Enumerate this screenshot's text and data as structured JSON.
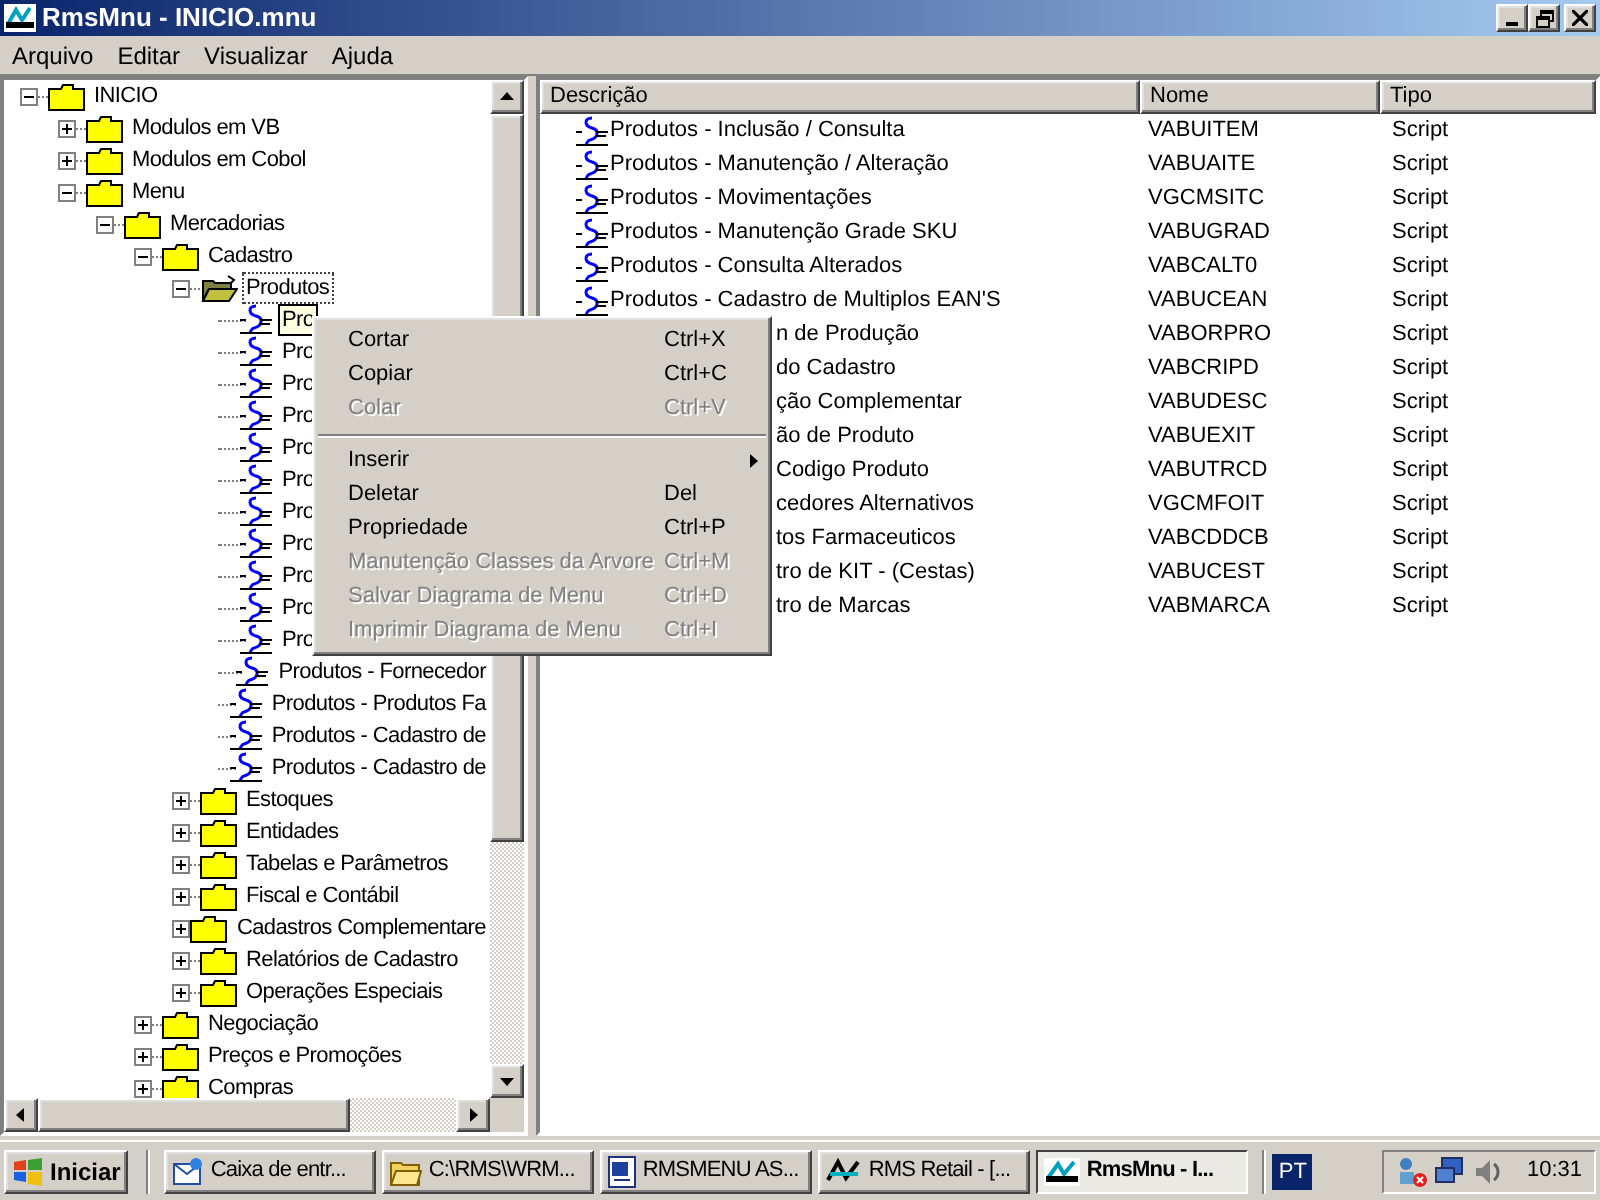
{
  "window": {
    "title": "RmsMnu - INICIO.mnu"
  },
  "menu_bar": [
    "Arquivo",
    "Editar",
    "Visualizar",
    "Ajuda"
  ],
  "tree": [
    {
      "label": "INICIO",
      "kind": "folder",
      "expanded": true,
      "selected": false,
      "focused": false,
      "children": [
        {
          "label": "Modulos em VB",
          "kind": "folder",
          "expanded": false,
          "selected": false,
          "focused": false
        },
        {
          "label": "Modulos em Cobol",
          "kind": "folder",
          "expanded": false,
          "selected": false,
          "focused": false
        },
        {
          "label": "Menu",
          "kind": "folder",
          "expanded": true,
          "selected": false,
          "focused": false,
          "children": [
            {
              "label": "Mercadorias",
              "kind": "folder",
              "expanded": true,
              "selected": false,
              "focused": false,
              "children": [
                {
                  "label": "Cadastro",
                  "kind": "folder",
                  "expanded": true,
                  "selected": false,
                  "focused": false,
                  "children": [
                    {
                      "label": "Produtos",
                      "kind": "folder",
                      "expanded": true,
                      "selected": false,
                      "focused": true,
                      "children": [
                        {
                          "label": "Pro",
                          "kind": "script",
                          "selected": true,
                          "focused": false
                        },
                        {
                          "label": "Pro",
                          "kind": "script",
                          "selected": false,
                          "focused": false
                        },
                        {
                          "label": "Pro",
                          "kind": "script",
                          "selected": false,
                          "focused": false
                        },
                        {
                          "label": "Pro",
                          "kind": "script",
                          "selected": false,
                          "focused": false
                        },
                        {
                          "label": "Pro",
                          "kind": "script",
                          "selected": false,
                          "focused": false
                        },
                        {
                          "label": "Pro",
                          "kind": "script",
                          "selected": false,
                          "focused": false
                        },
                        {
                          "label": "Pro",
                          "kind": "script",
                          "selected": false,
                          "focused": false
                        },
                        {
                          "label": "Pro",
                          "kind": "script",
                          "selected": false,
                          "focused": false
                        },
                        {
                          "label": "Pro",
                          "kind": "script",
                          "selected": false,
                          "focused": false
                        },
                        {
                          "label": "Pro",
                          "kind": "script",
                          "selected": false,
                          "focused": false
                        },
                        {
                          "label": "Pro",
                          "kind": "script",
                          "selected": false,
                          "focused": false
                        },
                        {
                          "label": "Produtos - Fornecedor",
                          "kind": "script",
                          "selected": false,
                          "focused": false
                        },
                        {
                          "label": "Produtos - Produtos Fa",
                          "kind": "script",
                          "selected": false,
                          "focused": false
                        },
                        {
                          "label": "Produtos - Cadastro de",
                          "kind": "script",
                          "selected": false,
                          "focused": false
                        },
                        {
                          "label": "Produtos - Cadastro de",
                          "kind": "script",
                          "selected": false,
                          "focused": false
                        }
                      ]
                    },
                    {
                      "label": "Estoques",
                      "kind": "folder",
                      "expanded": false,
                      "selected": false,
                      "focused": false
                    },
                    {
                      "label": "Entidades",
                      "kind": "folder",
                      "expanded": false,
                      "selected": false,
                      "focused": false
                    },
                    {
                      "label": "Tabelas e Parâmetros",
                      "kind": "folder",
                      "expanded": false,
                      "selected": false,
                      "focused": false
                    },
                    {
                      "label": "Fiscal e Contábil",
                      "kind": "folder",
                      "expanded": false,
                      "selected": false,
                      "focused": false
                    },
                    {
                      "label": "Cadastros Complementare",
                      "kind": "folder",
                      "expanded": false,
                      "selected": false,
                      "focused": false
                    },
                    {
                      "label": "Relatórios de Cadastro",
                      "kind": "folder",
                      "expanded": false,
                      "selected": false,
                      "focused": false
                    },
                    {
                      "label": "Operações Especiais",
                      "kind": "folder",
                      "expanded": false,
                      "selected": false,
                      "focused": false
                    }
                  ]
                },
                {
                  "label": "Negociação",
                  "kind": "folder",
                  "expanded": false,
                  "selected": false,
                  "focused": false
                },
                {
                  "label": "Preços e Promoções",
                  "kind": "folder",
                  "expanded": false,
                  "selected": false,
                  "focused": false
                },
                {
                  "label": "Compras",
                  "kind": "folder",
                  "expanded": false,
                  "selected": false,
                  "focused": false
                }
              ]
            }
          ]
        }
      ]
    }
  ],
  "list": {
    "columns": [
      "Descrição",
      "Nome",
      "Tipo"
    ],
    "rows": [
      {
        "kind": "full",
        "description": "Produtos - Inclusão / Consulta",
        "name": "VABUITEM",
        "type": "Script"
      },
      {
        "kind": "full",
        "description": "Produtos - Manutenção / Alteração",
        "name": "VABUAITE",
        "type": "Script"
      },
      {
        "kind": "full",
        "description": "Produtos - Movimentações",
        "name": "VGCMSITC",
        "type": "Script"
      },
      {
        "kind": "full",
        "description": "Produtos - Manutenção Grade SKU",
        "name": "VABUGRAD",
        "type": "Script"
      },
      {
        "kind": "full",
        "description": "Produtos - Consulta Alterados",
        "name": "VABCALT0",
        "type": "Script"
      },
      {
        "kind": "full",
        "description": "Produtos - Cadastro de Multiplos EAN'S",
        "name": "VABUCEAN",
        "type": "Script"
      },
      {
        "kind": "partial",
        "description": "n de Produção",
        "name": "VABORPRO",
        "type": "Script"
      },
      {
        "kind": "partial",
        "description": "do Cadastro",
        "name": "VABCRIPD",
        "type": "Script"
      },
      {
        "kind": "partial",
        "description": "ção Complementar",
        "name": "VABUDESC",
        "type": "Script"
      },
      {
        "kind": "partial",
        "description": "ão de Produto",
        "name": "VABUEXIT",
        "type": "Script"
      },
      {
        "kind": "partial",
        "description": "Codigo Produto",
        "name": "VABUTRCD",
        "type": "Script"
      },
      {
        "kind": "partial",
        "description": "cedores Alternativos",
        "name": "VGCMFOIT",
        "type": "Script"
      },
      {
        "kind": "partial",
        "description": "tos Farmaceuticos",
        "name": "VABCDDCB",
        "type": "Script"
      },
      {
        "kind": "partial",
        "description": "tro de KIT - (Cestas)",
        "name": "VABUCEST",
        "type": "Script"
      },
      {
        "kind": "partial",
        "description": "tro de Marcas",
        "name": "VABMARCA",
        "type": "Script"
      }
    ]
  },
  "context_menu": [
    {
      "kind": "item",
      "label": "Cortar",
      "shortcut": "Ctrl+X",
      "disabled": false
    },
    {
      "kind": "item",
      "label": "Copiar",
      "shortcut": "Ctrl+C",
      "disabled": false
    },
    {
      "kind": "item",
      "label": "Colar",
      "shortcut": "Ctrl+V",
      "disabled": true
    },
    {
      "kind": "separator"
    },
    {
      "kind": "submenu",
      "label": "Inserir",
      "disabled": false
    },
    {
      "kind": "item",
      "label": "Deletar",
      "shortcut": "Del",
      "disabled": false
    },
    {
      "kind": "item",
      "label": "Propriedade",
      "shortcut": "Ctrl+P",
      "disabled": false
    },
    {
      "kind": "item",
      "label": "Manutenção Classes da Arvore",
      "shortcut": "Ctrl+M",
      "disabled": true
    },
    {
      "kind": "item",
      "label": "Salvar Diagrama de Menu",
      "shortcut": "Ctrl+D",
      "disabled": true
    },
    {
      "kind": "item",
      "label": "Imprimir Diagrama de Menu",
      "shortcut": "Ctrl+I",
      "disabled": true
    }
  ],
  "taskbar": {
    "start": "Iniciar",
    "tasks": [
      {
        "kind": "mail",
        "label": "Caixa de entr...",
        "selected": false
      },
      {
        "kind": "folder",
        "label": "C:\\RMS\\WRM...",
        "selected": false
      },
      {
        "kind": "document",
        "label": "RMSMENU AS...",
        "selected": false
      },
      {
        "kind": "retail",
        "label": "RMS Retail - [...",
        "selected": false
      },
      {
        "kind": "app",
        "label": "RmsMnu - I...",
        "selected": true
      }
    ],
    "language": "PT",
    "clock": "10:31"
  }
}
